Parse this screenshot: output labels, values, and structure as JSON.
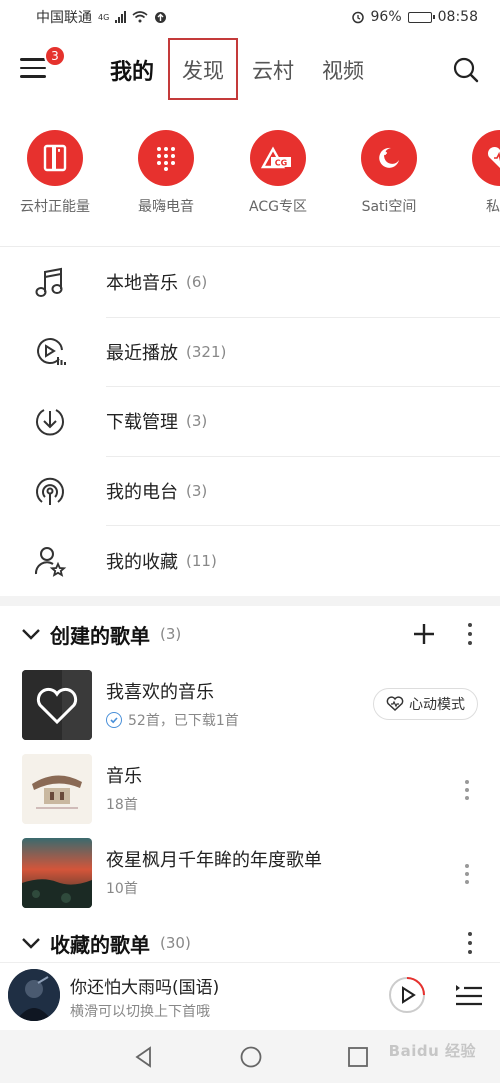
{
  "status_bar": {
    "carrier": "中国联通",
    "network": "4G",
    "battery": "96%",
    "time": "08:58",
    "battery_level": 0.96
  },
  "header": {
    "menu_badge": "3",
    "tabs": [
      {
        "label": "我的",
        "active": true
      },
      {
        "label": "发现",
        "active": false
      },
      {
        "label": "云村",
        "active": false
      },
      {
        "label": "视频",
        "active": false
      }
    ],
    "icons": {
      "menu": "menu-icon",
      "search": "search-icon"
    }
  },
  "categories": [
    {
      "label": "云村正能量",
      "icon": "bookmark-icon"
    },
    {
      "label": "最嗨电音",
      "icon": "dots-grid-icon"
    },
    {
      "label": "ACG专区",
      "icon": "acg-icon"
    },
    {
      "label": "Sati空间",
      "icon": "moon-icon"
    },
    {
      "label": "私藏",
      "icon": "heart-wave-icon"
    }
  ],
  "my_items": [
    {
      "label": "本地音乐",
      "count": "(6)",
      "icon": "music-note-icon"
    },
    {
      "label": "最近播放",
      "count": "(321)",
      "icon": "recent-play-icon"
    },
    {
      "label": "下载管理",
      "count": "(3)",
      "icon": "download-icon"
    },
    {
      "label": "我的电台",
      "count": "(3)",
      "icon": "radio-icon"
    },
    {
      "label": "我的收藏",
      "count": "(11)",
      "icon": "user-star-icon"
    }
  ],
  "created_section": {
    "title": "创建的歌单",
    "count": "(3)"
  },
  "playlists": [
    {
      "name": "我喜欢的音乐",
      "sub": "52首，已下载1首",
      "button": "心动模式",
      "downloaded": true
    },
    {
      "name": "音乐",
      "sub": "18首"
    },
    {
      "name": "夜星枫月千年眸的年度歌单",
      "sub": "10首"
    }
  ],
  "collected_section": {
    "title": "收藏的歌单",
    "count": "(30)"
  },
  "player": {
    "title": "你还怕大雨吗(国语)",
    "subtitle": "横滑可以切换上下首哦"
  },
  "watermark": "Baidu 经验",
  "colors": {
    "accent": "#e7312e",
    "highlight_box": "#c43a3a"
  }
}
